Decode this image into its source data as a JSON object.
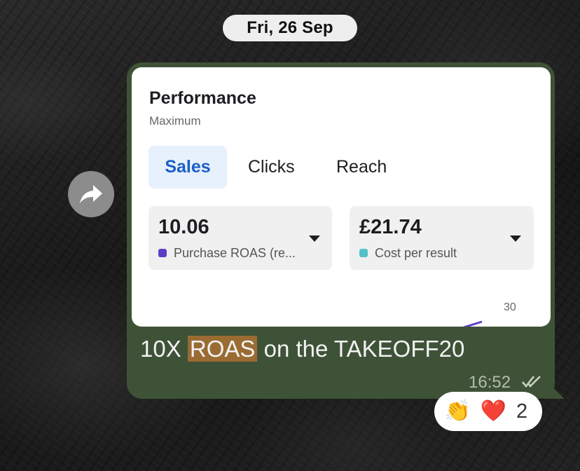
{
  "date_separator": "Fri, 26 Sep",
  "message": {
    "preview": {
      "title": "Performance",
      "subtitle": "Maximum",
      "tabs": [
        {
          "label": "Sales",
          "active": true
        },
        {
          "label": "Clicks",
          "active": false
        },
        {
          "label": "Reach",
          "active": false
        }
      ],
      "metrics": [
        {
          "value": "10.06",
          "label": "Purchase ROAS (re...",
          "color": "#5b3fc4"
        },
        {
          "value": "£21.74",
          "label": "Cost per result",
          "color": "#52c2c8"
        }
      ],
      "axis_tick": "30"
    },
    "text_before": "10X ",
    "text_highlight": "ROAS",
    "text_after": " on the TAKEOFF20",
    "time": "16:52",
    "status_icon": "double-check-icon"
  },
  "reactions": {
    "items": [
      {
        "emoji": "👏",
        "name": "clapping-hands-emoji"
      },
      {
        "emoji": "❤️",
        "name": "red-heart-emoji"
      }
    ],
    "count": "2"
  },
  "colors": {
    "bubble": "#3e5237",
    "active_tab_bg": "#e7f0fd",
    "active_tab_text": "#1a5fc7",
    "highlight": "#9a6b33"
  }
}
